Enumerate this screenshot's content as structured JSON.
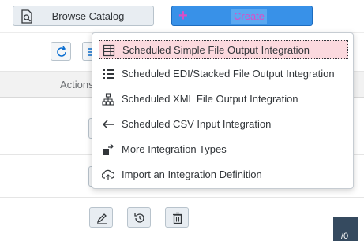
{
  "toolbar": {
    "browse_label": "Browse Catalog",
    "create_label": "Create"
  },
  "table": {
    "actions_header": "Actions"
  },
  "menu": {
    "items": [
      {
        "label": "Scheduled Simple File Output Integration",
        "icon": "grid-table-icon",
        "active": true
      },
      {
        "label": "Scheduled EDI/Stacked File Output Integration",
        "icon": "stacked-list-icon",
        "active": false
      },
      {
        "label": "Scheduled XML File Output Integration",
        "icon": "hierarchy-icon",
        "active": false
      },
      {
        "label": "Scheduled CSV Input Integration",
        "icon": "arrow-left-icon",
        "active": false
      },
      {
        "label": "More Integration Types",
        "icon": "export-box-icon",
        "active": false
      },
      {
        "label": "Import an Integration Definition",
        "icon": "cloud-upload-icon",
        "active": false
      }
    ]
  },
  "corner": {
    "text": "/0"
  },
  "colors": {
    "accent": "#3891e8",
    "highlight": "#fbd9de",
    "icon": "#0a6ed1",
    "create_text": "#d94ec7"
  }
}
